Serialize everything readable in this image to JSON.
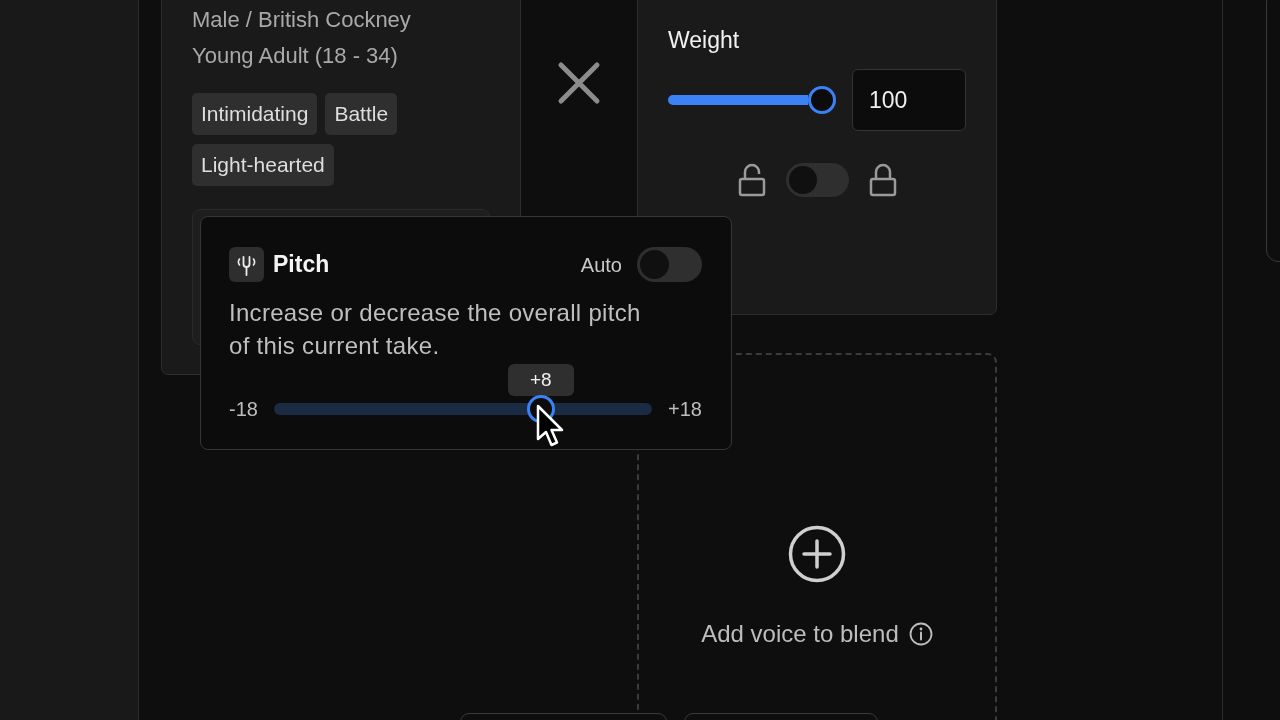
{
  "voice_card": {
    "accent": "Male / British Cockney",
    "age": "Young Adult (18 - 34)",
    "tags": [
      "Intimidating",
      "Battle",
      "Light-hearted"
    ]
  },
  "weight": {
    "label": "Weight",
    "slider": {
      "level": 1.0
    },
    "value": "100",
    "lock": {
      "on": false
    }
  },
  "pitch": {
    "title": "Pitch",
    "auto": {
      "label": "Auto",
      "on": false
    },
    "description": "Increase or decrease the overall pitch of this current take.",
    "slider": {
      "min_label": "-18",
      "max_label": "+18",
      "level": 0.722,
      "tooltip": "+8"
    }
  },
  "add_voice": {
    "label": "Add voice to blend"
  }
}
